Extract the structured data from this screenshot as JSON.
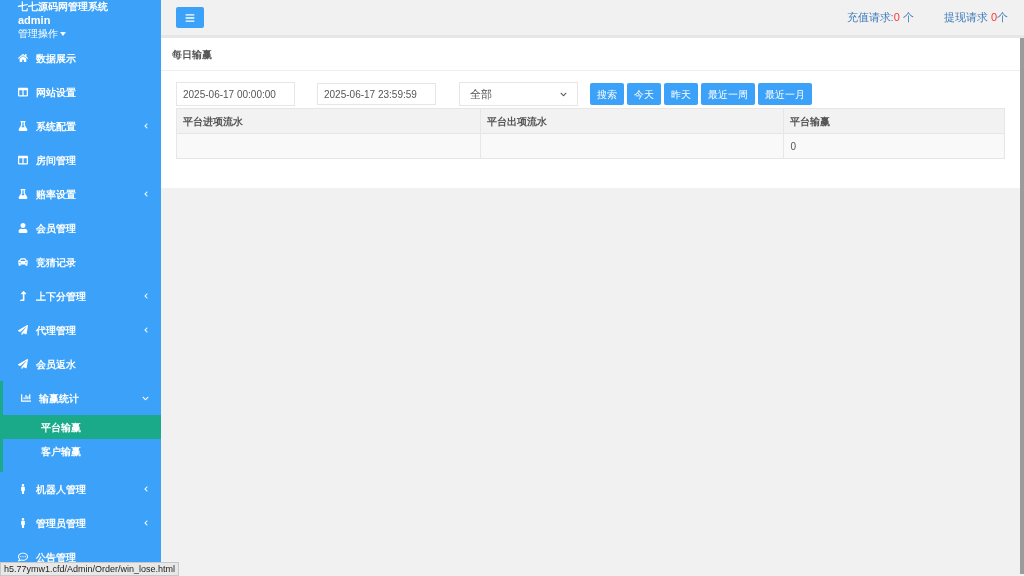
{
  "sidebar": {
    "title": "七七源码网管理系统",
    "user": "admin",
    "user_menu": "管理操作",
    "items": [
      {
        "label": "数据展示"
      },
      {
        "label": "网站设置"
      },
      {
        "label": "系统配置",
        "expanded": false
      },
      {
        "label": "房间管理"
      },
      {
        "label": "赔率设置",
        "expanded": false
      },
      {
        "label": "会员管理"
      },
      {
        "label": "竞猜记录"
      },
      {
        "label": "上下分管理",
        "expanded": false
      },
      {
        "label": "代理管理",
        "expanded": false
      },
      {
        "label": "会员返水"
      },
      {
        "label": "输赢统计",
        "expanded": true,
        "children": [
          {
            "label": "平台输赢",
            "selected": true
          },
          {
            "label": "客户输赢",
            "selected": false
          }
        ]
      },
      {
        "label": "机器人管理",
        "expanded": false
      },
      {
        "label": "管理员管理",
        "expanded": false
      },
      {
        "label": "公告管理"
      }
    ]
  },
  "topbar": {
    "requests": [
      {
        "label": "充值请求:",
        "count": "0",
        "unit": " 个"
      },
      {
        "label": "提现请求 ",
        "count": "0",
        "unit": "个"
      }
    ]
  },
  "panel": {
    "title": "每日输赢",
    "start": "2025-06-17 00:00:00",
    "end": "2025-06-17 23:59:59",
    "filter": "全部",
    "buttons": [
      "搜索",
      "今天",
      "昨天",
      "最近一周",
      "最近一月"
    ],
    "table": {
      "columns": [
        "平台进项流水",
        "平台出项流水",
        "平台输赢"
      ],
      "rows": [
        [
          "",
          "",
          "0"
        ]
      ]
    }
  },
  "status_bar": "h5.77ymw1.cfd/Admin/Order/win_lose.html"
}
